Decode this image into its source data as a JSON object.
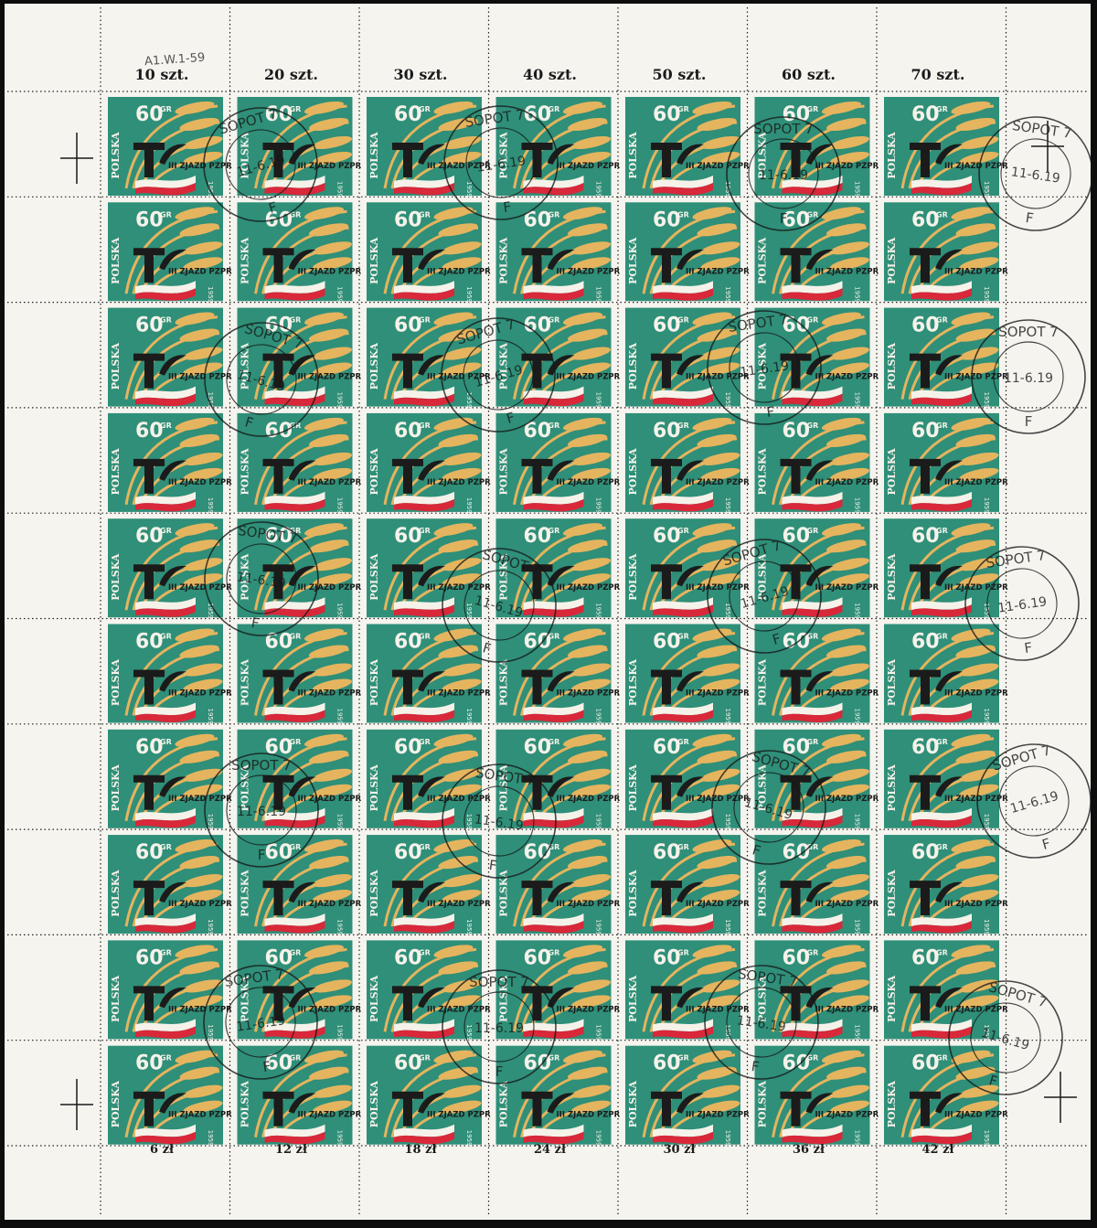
{
  "sheet": {
    "pencil_note": "A1.W.1-59",
    "column_counts": [
      "10 szt.",
      "20 szt.",
      "30 szt.",
      "40 szt.",
      "50 szt.",
      "60 szt.",
      "70 szt."
    ],
    "row_values": [
      "6 zł",
      "12 zł",
      "18 zł",
      "24 zł",
      "30 zł",
      "36 zł",
      "42 zł"
    ],
    "rows": 10,
    "columns": 7
  },
  "stamp": {
    "country": "POLSKA",
    "value": "60",
    "currency": "GR",
    "inscription": "III ZJAZD PZPR",
    "year": "1959",
    "colors": {
      "background": "#2f8f78",
      "wheat": "#e5b45f",
      "hammer": "#1b1b1b",
      "flag_white": "#f5f2ea",
      "flag_red": "#d8283a"
    }
  },
  "postmark": {
    "town": "SOPOT 7",
    "date": "11-6.19",
    "code": "F"
  },
  "colors": {
    "margin": "#f6f4ef",
    "backing": "#0d0d0d",
    "perforation": "#222222",
    "ink": "#1a1a1a"
  }
}
